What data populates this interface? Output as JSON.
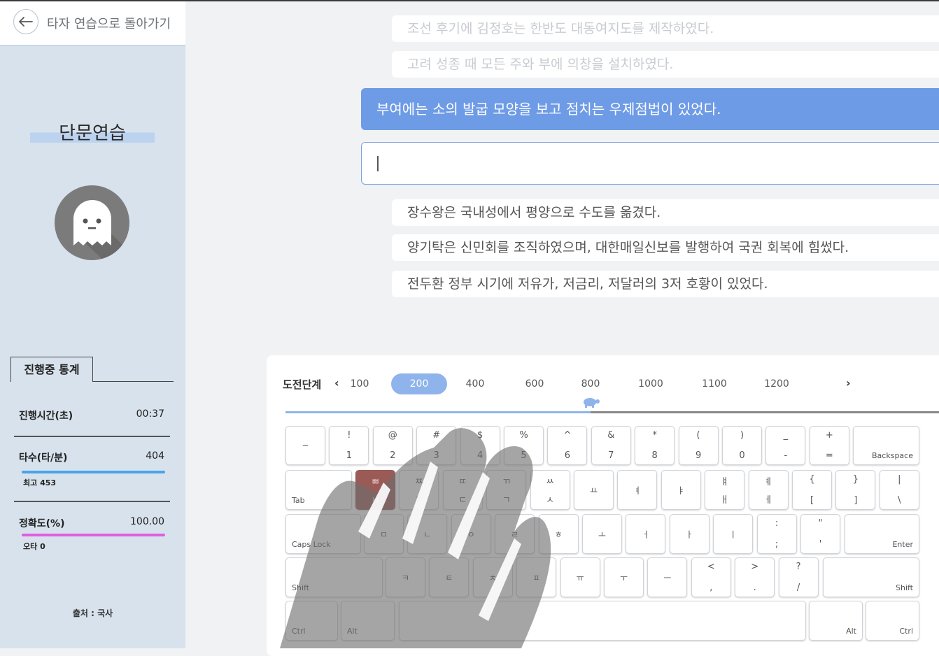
{
  "nav": {
    "back_label": "타자 연습으로 돌아가기"
  },
  "sidebar": {
    "mode_title": "단문연습",
    "stats_tab": "진행중 통계",
    "stats": {
      "time_label": "진행시간(초)",
      "time_value": "00:37",
      "speed_label": "타수(타/분)",
      "speed_value": "404",
      "speed_best": "최고 453",
      "speed_fraction": 1.0,
      "accuracy_label": "정확도(%)",
      "accuracy_value": "100.00",
      "typo": "오타 0",
      "accuracy_fraction": 1.0
    },
    "source": "출처 : 국사"
  },
  "sentences": {
    "done": [
      "조선 후기에 김정호는 한반도 대동여지도를 제작하였다.",
      "고려 성종 때 모든 주와 부에 의창을 설치하였다."
    ],
    "current": "부여에는 소의 발굽 모양을 보고 점치는 우제점법이 있었다.",
    "input_value": "",
    "next": [
      "장수왕은 국내성에서 평양으로 수도를 옮겼다.",
      "양기탁은 신민회를 조직하였으며, 대한매일신보를 발행하여 국권 회복에 힘썼다.",
      "전두환 정부 시기에 저유가, 저금리, 저달러의 3저 호황이 있었다."
    ]
  },
  "challenge": {
    "label": "도전단계",
    "prev": "‹",
    "next": "›",
    "levels": [
      "100",
      "200",
      "400",
      "600",
      "800",
      "1000",
      "1100",
      "1200"
    ],
    "selected": "200",
    "progress_value": 800
  },
  "keyboard": {
    "row1": [
      [
        "~",
        ""
      ],
      [
        "!",
        "1"
      ],
      [
        "@",
        "2"
      ],
      [
        "#",
        "3"
      ],
      [
        "$",
        "4"
      ],
      [
        "%",
        "5"
      ],
      [
        "^",
        "6"
      ],
      [
        "&",
        "7"
      ],
      [
        "*",
        "8"
      ],
      [
        "(",
        "9"
      ],
      [
        ")",
        "0"
      ],
      [
        "_",
        "-"
      ],
      [
        "+",
        "="
      ]
    ],
    "backspace": "Backspace",
    "tab": "Tab",
    "row2": [
      [
        "ㅃ",
        "ㅂ"
      ],
      [
        "ㅉ",
        "ㅈ"
      ],
      [
        "ㄸ",
        "ㄷ"
      ],
      [
        "ㄲ",
        "ㄱ"
      ],
      [
        "ㅆ",
        "ㅅ"
      ],
      [
        "",
        "ㅛ"
      ],
      [
        "",
        "ㅕ"
      ],
      [
        "",
        "ㅑ"
      ],
      [
        "ㅒ",
        "ㅐ"
      ],
      [
        "ㅖ",
        "ㅔ"
      ],
      [
        "{",
        "["
      ],
      [
        "}",
        "]"
      ],
      [
        "|",
        "\\"
      ]
    ],
    "caps": "Caps Lock",
    "row3": [
      [
        "",
        "ㅁ"
      ],
      [
        "",
        "ㄴ"
      ],
      [
        "",
        "ㅇ"
      ],
      [
        "",
        "ㄹ"
      ],
      [
        "",
        "ㅎ"
      ],
      [
        "",
        "ㅗ"
      ],
      [
        "",
        "ㅓ"
      ],
      [
        "",
        "ㅏ"
      ],
      [
        "",
        "ㅣ"
      ],
      [
        ":",
        ";"
      ],
      [
        "\"",
        "'"
      ]
    ],
    "enter": "Enter",
    "shift": "Shift",
    "row4": [
      [
        "",
        "ㅋ"
      ],
      [
        "",
        "ㅌ"
      ],
      [
        "",
        "ㅊ"
      ],
      [
        "",
        "ㅍ"
      ],
      [
        "",
        "ㅠ"
      ],
      [
        "",
        "ㅜ"
      ],
      [
        "",
        "ㅡ"
      ],
      [
        "<",
        ","
      ],
      [
        ">",
        "."
      ],
      [
        "?",
        "/"
      ]
    ],
    "ctrl": "Ctrl",
    "alt": "Alt",
    "highlight_key": "ㅂ"
  },
  "colors": {
    "accent": "#6e9be6",
    "speed_bar": "#4aa3e8",
    "accuracy_bar": "#e05fe0",
    "highlight": "#9a5a56",
    "sidebar_bg": "#d7e2ec"
  }
}
